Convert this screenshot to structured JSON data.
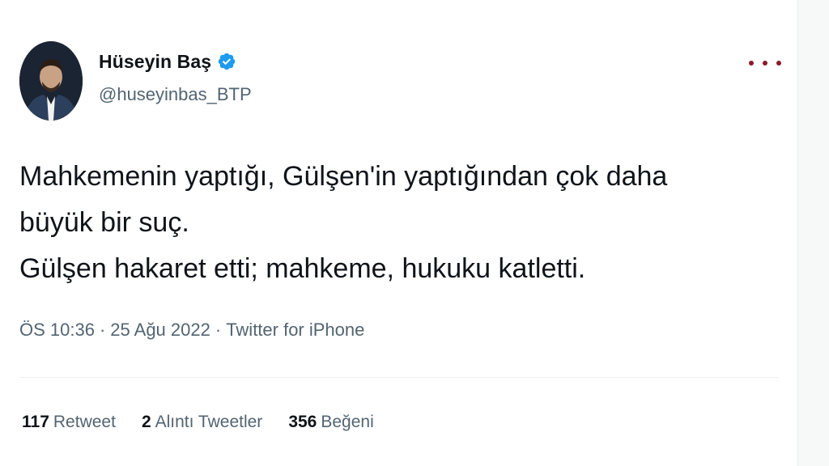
{
  "author": {
    "name": "Hüseyin Baş",
    "handle": "@huseyinbas_BTP",
    "verified": true,
    "verified_color": "#1d9bf0"
  },
  "tweet": {
    "lines": [
      "Mahkemenin yaptığı, Gülşen'in yaptığından çok daha",
      "büyük bir suç.",
      "Gülşen hakaret etti; mahkeme, hukuku katletti."
    ]
  },
  "meta": {
    "time": "ÖS 10:36",
    "date": "25 Ağu 2022",
    "source": "Twitter for iPhone",
    "separator": "·"
  },
  "stats": {
    "retweets": {
      "count": "117",
      "label": "Retweet"
    },
    "quotes": {
      "count": "2",
      "label": "Alıntı Tweetler"
    },
    "likes": {
      "count": "356",
      "label": "Beğeni"
    }
  },
  "icons": {
    "verified": "verified-badge-icon",
    "more": "more-options-icon"
  },
  "colors": {
    "text_primary": "#0f1419",
    "text_secondary": "#536471",
    "accent": "#1d9bf0"
  }
}
